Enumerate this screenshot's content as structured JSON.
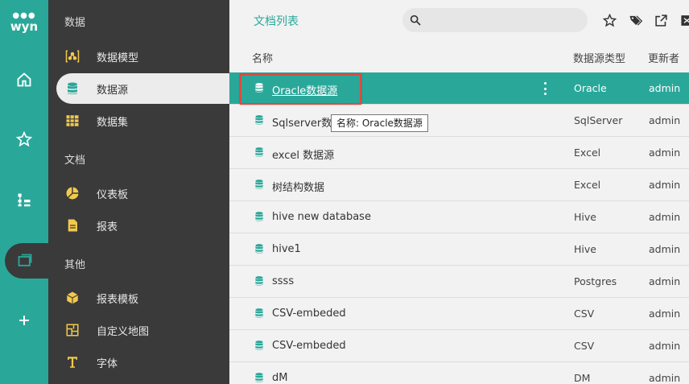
{
  "rail": {
    "logo_text": "wyn",
    "items": [
      {
        "name": "home"
      },
      {
        "name": "favorites"
      },
      {
        "name": "hierarchy"
      },
      {
        "name": "documents",
        "active": true
      },
      {
        "name": "create"
      }
    ]
  },
  "nav": {
    "sections": [
      {
        "label": "数据"
      },
      {
        "label": "文档"
      },
      {
        "label": "其他"
      }
    ],
    "items": [
      {
        "label": "数据模型",
        "icon": "data-model-icon"
      },
      {
        "label": "数据源",
        "icon": "database-icon",
        "active": true
      },
      {
        "label": "数据集",
        "icon": "dataset-icon"
      },
      {
        "label": "仪表板",
        "icon": "dashboard-icon"
      },
      {
        "label": "报表",
        "icon": "report-icon"
      },
      {
        "label": "报表模板",
        "icon": "report-template-icon"
      },
      {
        "label": "自定义地图",
        "icon": "custom-map-icon"
      },
      {
        "label": "字体",
        "icon": "font-icon"
      }
    ]
  },
  "main": {
    "title": "文档列表",
    "search": {
      "placeholder": ""
    },
    "columns": {
      "name": "名称",
      "type": "数据源类型",
      "owner": "更新者"
    },
    "rows": [
      {
        "name": "Oracle数据源",
        "type": "Oracle",
        "owner": "admin",
        "selected": true
      },
      {
        "name": "Sqlserver数据源",
        "type": "SqlServer",
        "owner": "admin"
      },
      {
        "name": "excel 数据源",
        "type": "Excel",
        "owner": "admin"
      },
      {
        "name": "树结构数据",
        "type": "Excel",
        "owner": "admin"
      },
      {
        "name": "hive new database",
        "type": "Hive",
        "owner": "admin"
      },
      {
        "name": "hive1",
        "type": "Hive",
        "owner": "admin"
      },
      {
        "name": "ssss",
        "type": "Postgres",
        "owner": "admin"
      },
      {
        "name": "CSV-embeded",
        "type": "CSV",
        "owner": "admin"
      },
      {
        "name": "CSV-embeded",
        "type": "CSV",
        "owner": "admin"
      },
      {
        "name": "dM",
        "type": "DM",
        "owner": "admin"
      }
    ],
    "tooltip": "名称: Oracle数据源"
  },
  "colors": {
    "accent": "#29a89a",
    "nav_bg": "#3a3a3a",
    "icon_yellow": "#f2c94c",
    "highlight": "#e0493f"
  }
}
